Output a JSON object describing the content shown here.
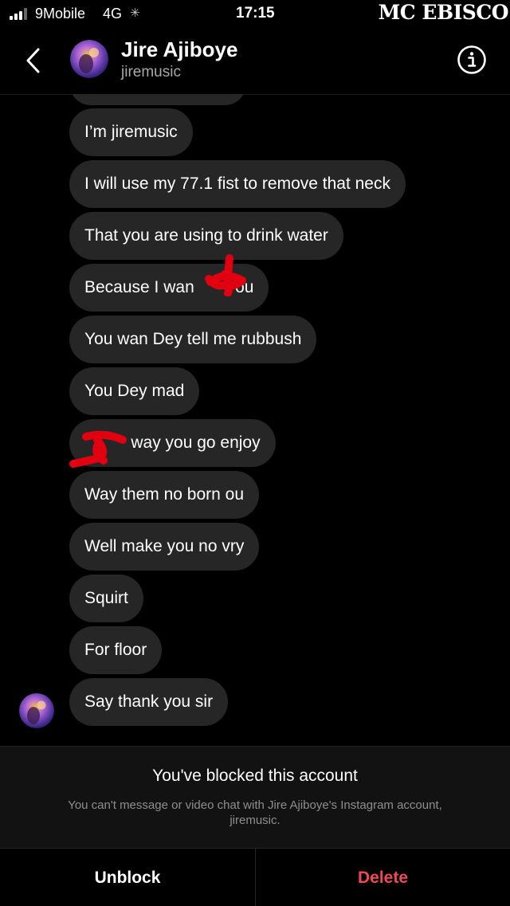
{
  "status_bar": {
    "carrier": "9Mobile",
    "network": "4G",
    "loading_icon": "spinner-icon",
    "time": "17:15"
  },
  "watermark": "MC EBISCO",
  "header": {
    "name": "Jire Ajiboye",
    "username": "jiremusic",
    "back_icon": "chevron-left-icon",
    "info_icon": "info-circle-icon"
  },
  "messages": [
    {
      "text": "I’m jiremusic"
    },
    {
      "text": "I will use my 77.1 fist to remove that neck"
    },
    {
      "text": "That you are using to drink water"
    },
    {
      "text": "Because I wan       you"
    },
    {
      "text": "You wan Dey tell me rubbush"
    },
    {
      "text": "You Dey mad"
    },
    {
      "text": "          way you go enjoy"
    },
    {
      "text": "Way them no born ou"
    },
    {
      "text": "Well make you no vry"
    },
    {
      "text": "Squirt"
    },
    {
      "text": "For floor"
    },
    {
      "text": "Say thank you sir"
    }
  ],
  "blocked": {
    "title": "You've blocked this account",
    "description": "You can't message or video chat with Jire Ajiboye's Instagram account, jiremusic."
  },
  "actions": {
    "unblock": "Unblock",
    "delete": "Delete"
  },
  "colors": {
    "background": "#000000",
    "bubble": "#262626",
    "delete_red": "#ed4956",
    "redaction": "#e0000f"
  }
}
